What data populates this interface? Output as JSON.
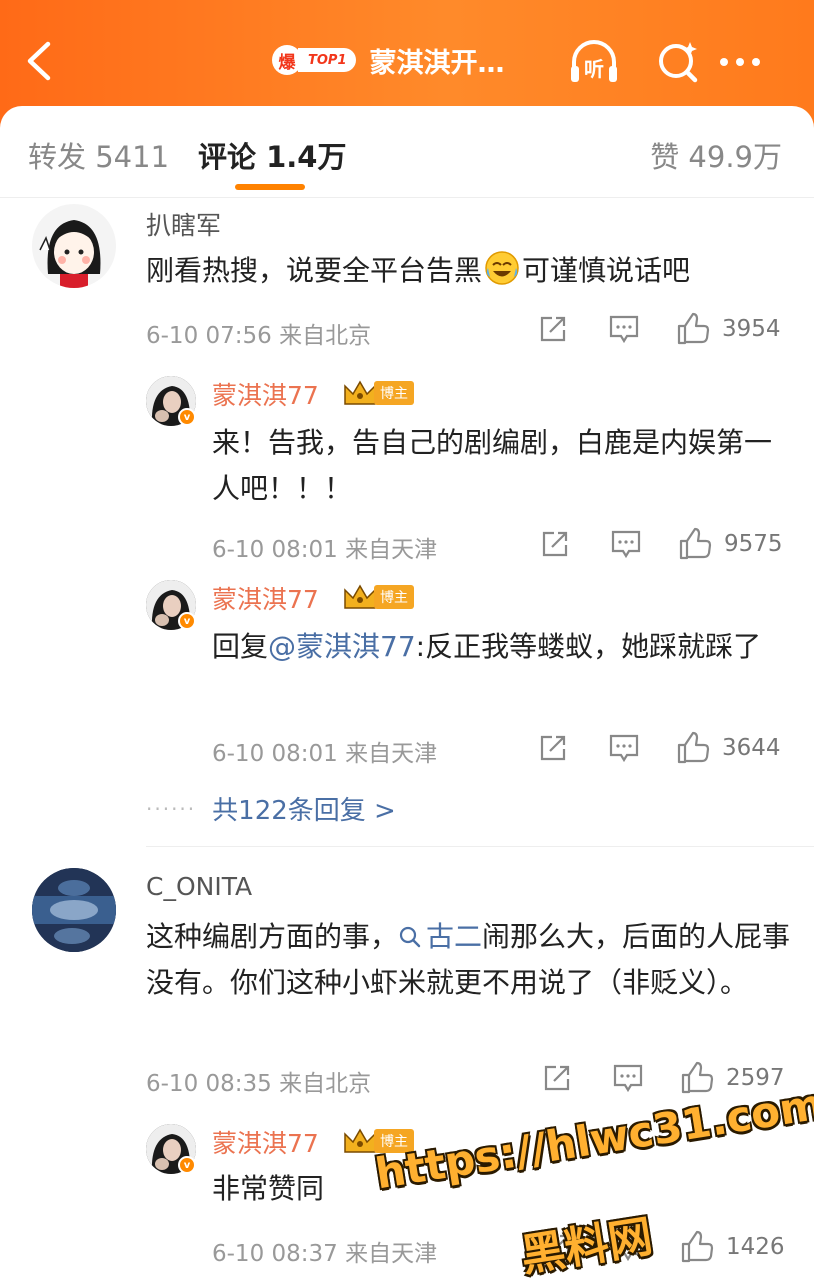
{
  "header": {
    "hot_char": "爆",
    "top_label": "TOP1",
    "title": "蒙淇淇开…",
    "listen_label": "听"
  },
  "tabs": {
    "repost": "转发 5411",
    "comments": "评论 1.4万",
    "likes": "赞 49.9万"
  },
  "comments": [
    {
      "user": "扒瞎军",
      "text": "刚看热搜，说要全平台告黑",
      "text_after_emoji": "可谨慎说话吧",
      "emoji": "crying-laughing-emoji",
      "time": "6-10 07:56 来自北京",
      "likes": "3954",
      "replies": [
        {
          "user": "蒙淇淇77",
          "badge": "博主",
          "text": "来！告我，告自己的剧编剧，白鹿是内娱第一人吧！！！",
          "time": "6-10 08:01 来自天津",
          "likes": "9575"
        },
        {
          "user": "蒙淇淇77",
          "badge": "博主",
          "reply_prefix": "回复",
          "mention": "@蒙淇淇77",
          "text": ":反正我等蝼蚁，她踩就踩了",
          "time": "6-10 08:01 来自天津",
          "likes": "3644"
        }
      ],
      "more_replies": "共122条回复 >"
    },
    {
      "user": "C_ONITA",
      "text_before": "这种编剧方面的事，",
      "search_link": "古二",
      "text_after": "闹那么大，后面的人屁事没有。你们这种小虾米就更不用说了（非贬义）。",
      "time": "6-10 08:35 来自北京",
      "likes": "2597",
      "replies": [
        {
          "user": "蒙淇淇77",
          "badge": "博主",
          "text": "非常赞同",
          "time": "6-10 08:37 来自天津",
          "likes": "1426"
        }
      ]
    }
  ],
  "watermark": {
    "url": "https://hlwc31.com",
    "name": "黑料网"
  },
  "colors": {
    "header_orange": "#ff7a1c",
    "username_orange": "#eb7350",
    "link_blue": "#4a6fa5",
    "tab_underline": "#ff8200"
  }
}
